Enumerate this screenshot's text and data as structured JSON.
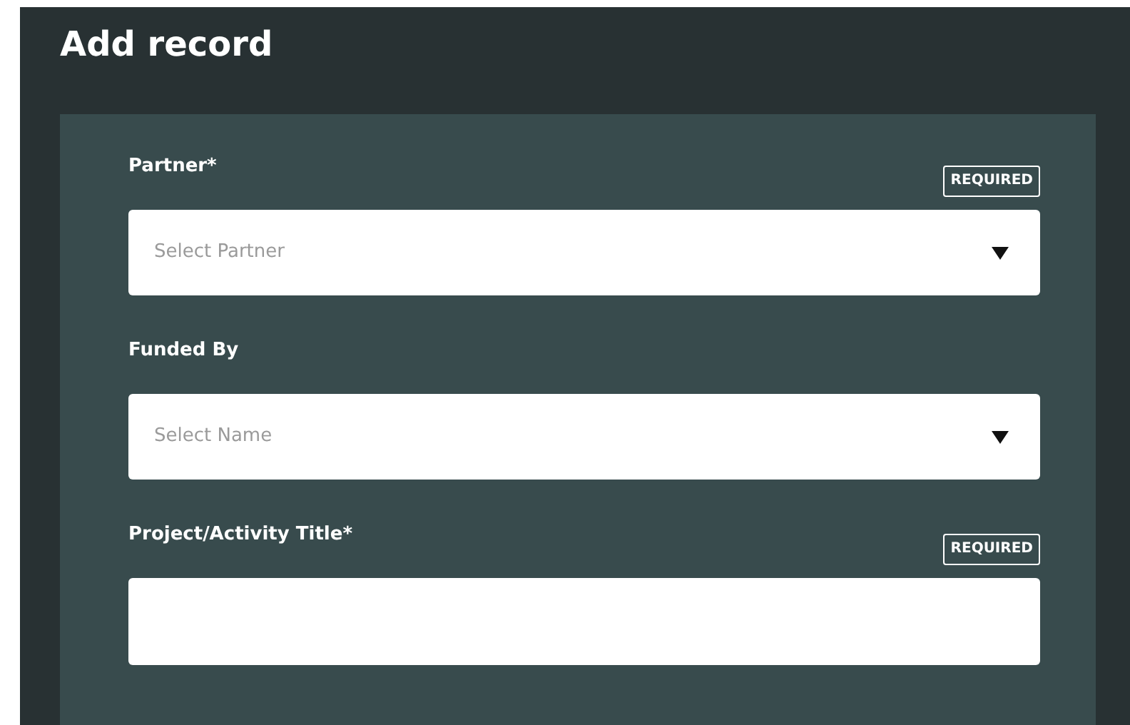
{
  "title": "Add record",
  "fields": [
    {
      "kind": "select",
      "label": "Partner*",
      "required": true,
      "required_badge": "REQUIRED",
      "placeholder": "Select Partner"
    },
    {
      "kind": "select",
      "label": "Funded By",
      "required": false,
      "placeholder": "Select Name"
    },
    {
      "kind": "text",
      "label": "Project/Activity Title*",
      "required": true,
      "required_badge": "REQUIRED"
    }
  ]
}
